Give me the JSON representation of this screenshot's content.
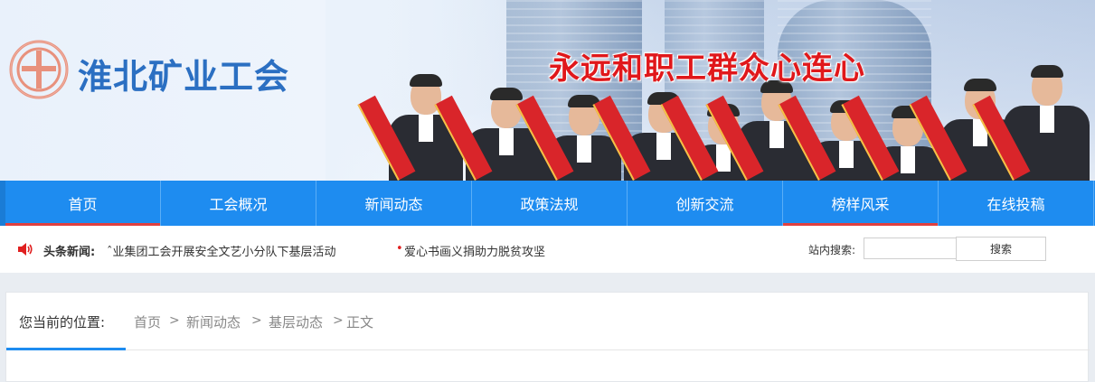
{
  "header": {
    "site_name": "淮北矿业工会",
    "slogan": "永远和职工群众心连心",
    "logo_icon": "union-logo-icon",
    "colors": {
      "site_name": "#2b6fc2",
      "slogan": "#e0181b",
      "logo": "#e8917d"
    }
  },
  "nav": {
    "items": [
      {
        "label": "首页"
      },
      {
        "label": "工会概况"
      },
      {
        "label": "新闻动态"
      },
      {
        "label": "政策法规"
      },
      {
        "label": "创新交流"
      },
      {
        "label": "榜样风采"
      },
      {
        "label": "在线投稿"
      }
    ],
    "background": "#1e8cf0",
    "accent": "#e04040"
  },
  "ticker": {
    "label": "头条新闻:",
    "items": [
      "ˆ业集团工会开展安全文艺小分队下基层活动",
      "爱心书画义捐助力脱贫攻坚"
    ],
    "icon": "speaker-icon"
  },
  "search": {
    "label": "站内搜索:",
    "value": "",
    "placeholder": "",
    "button_label": "搜索"
  },
  "breadcrumb": {
    "label": "您当前的位置:",
    "items": [
      "首页",
      "新闻动态",
      "基层动态",
      "正文"
    ],
    "separator": ">"
  }
}
